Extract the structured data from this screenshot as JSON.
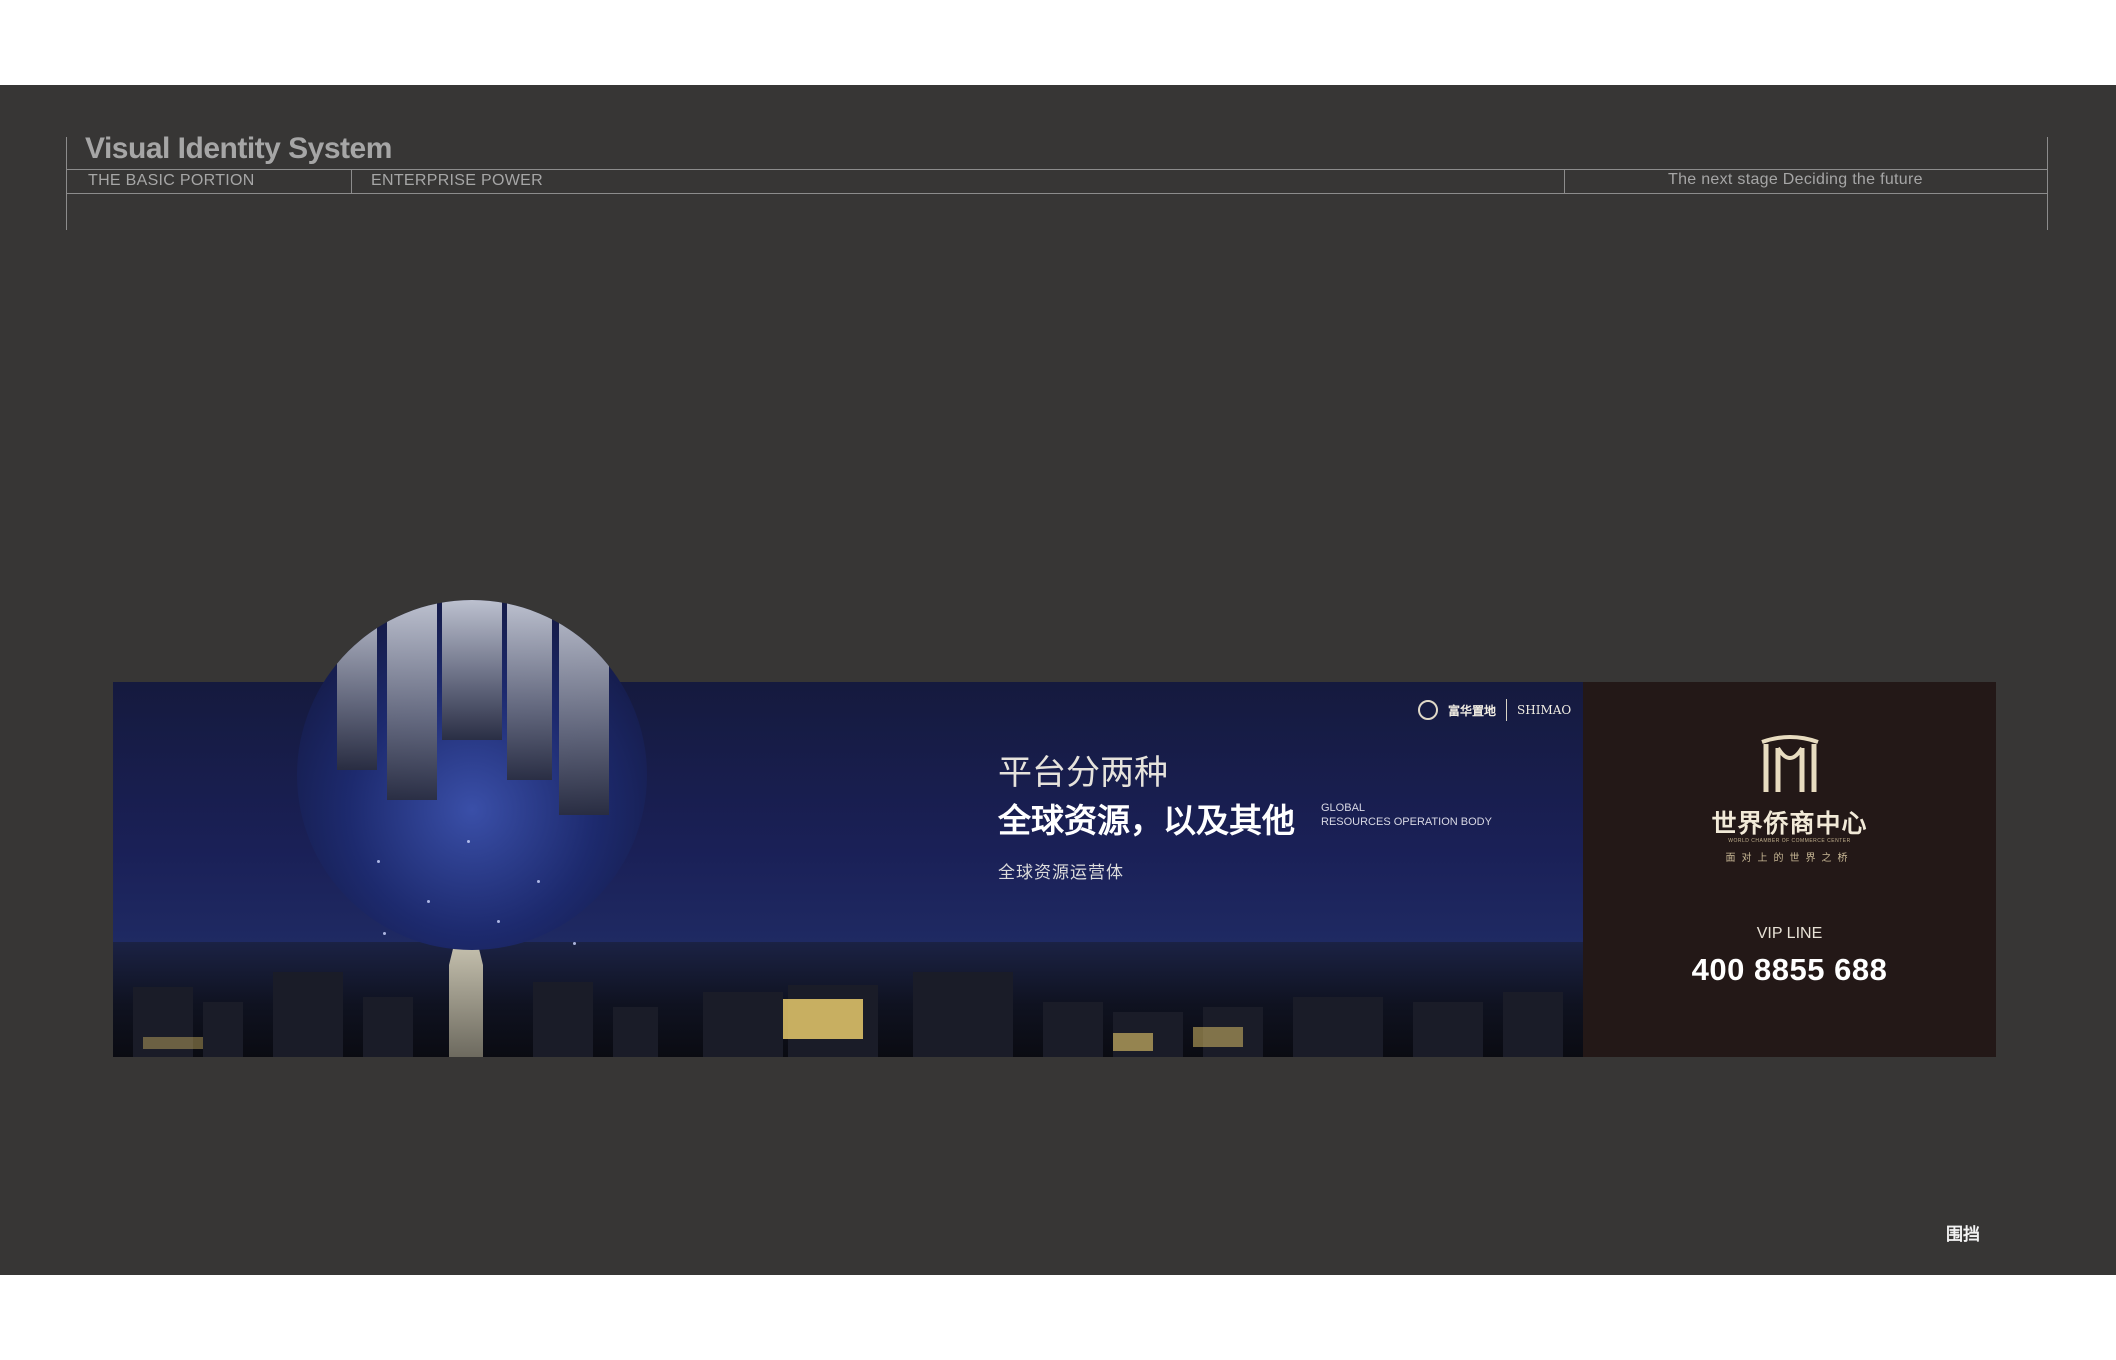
{
  "header": {
    "title": "Visual Identity System",
    "section_left": "THE BASIC PORTION",
    "section_mid": "ENTERPRISE POWER",
    "section_right": "The next stage Deciding the future"
  },
  "billboard": {
    "headline_line1": "平台分两种",
    "headline_line2": "全球资源，以及其他",
    "english_tag_line1": "GLOBAL",
    "english_tag_line2": "RESOURCES  OPERATION  BODY",
    "subline": "全球资源运营体",
    "developer_logo_1": "富华置地",
    "developer_logo_2": "SHIMAO",
    "brand_name": "世界侨商中心",
    "brand_english": "WORLD CHAMBER OF COMMERCE CENTER",
    "brand_slogan": "面对上的世界之桥",
    "vip_label": "VIP LINE",
    "vip_phone": "400 8855 688"
  },
  "page_label": "围挡",
  "colors": {
    "panel_background": "#373635",
    "billboard_night_sky": "#1a2057",
    "brand_panel": "#231817",
    "brand_gold": "#d9c9a3"
  }
}
